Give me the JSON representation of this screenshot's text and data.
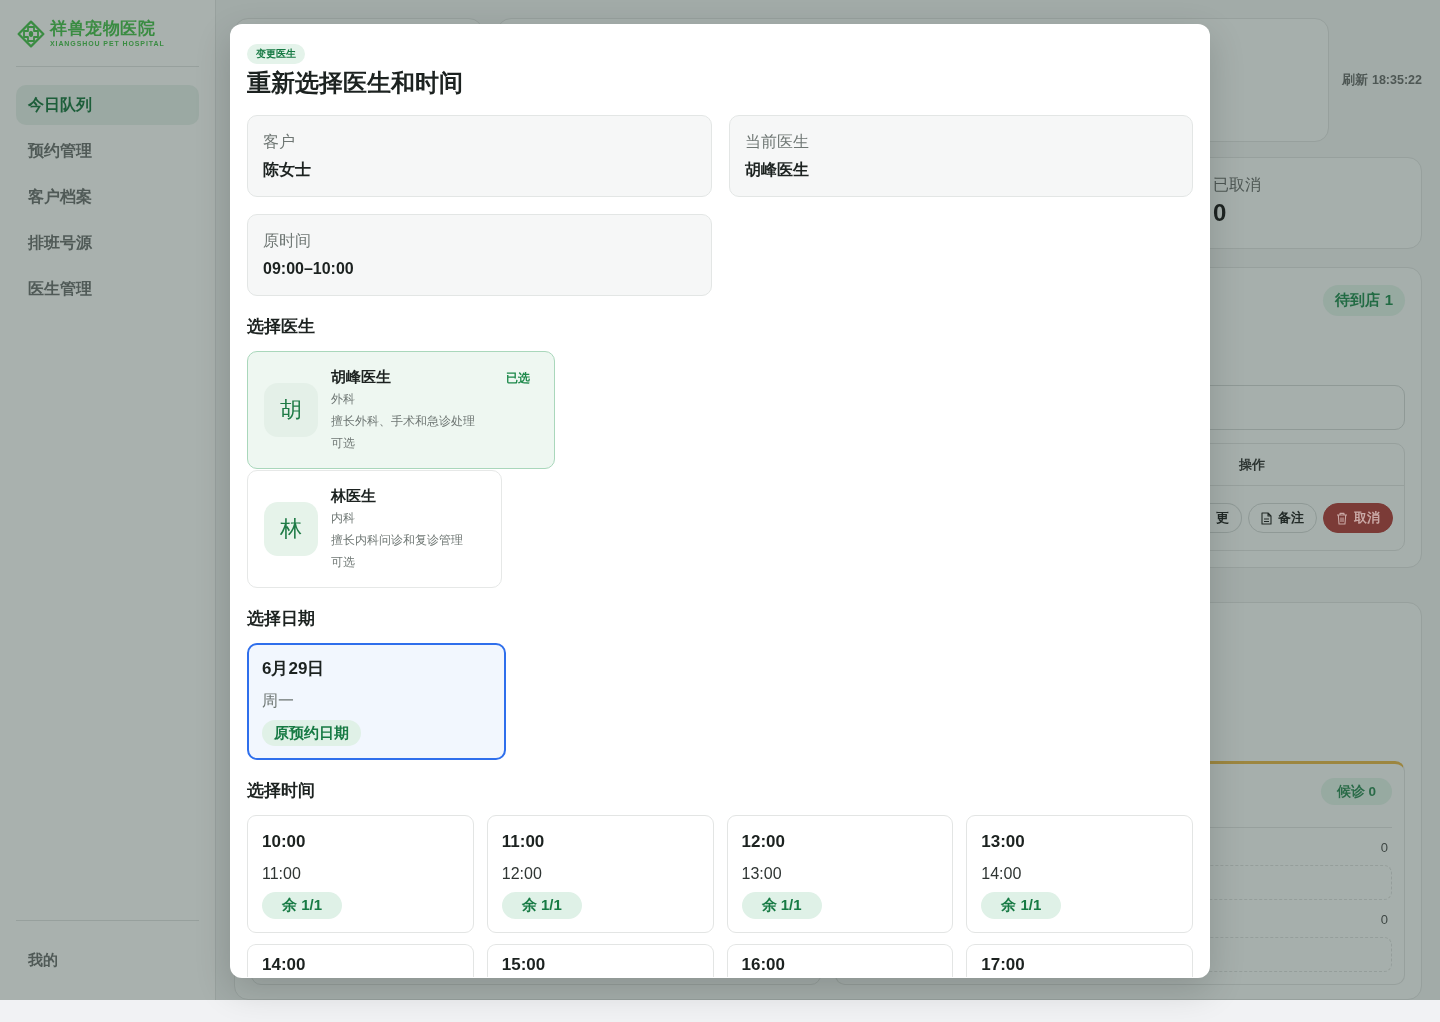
{
  "sidebar": {
    "logo": {
      "name": "祥兽宠物医院",
      "subtitle": "XIANGSHOU PET HOSPITAL"
    },
    "items": [
      {
        "label": "今日队列",
        "selected": true
      },
      {
        "label": "预约管理",
        "selected": false
      },
      {
        "label": "客户档案",
        "selected": false
      },
      {
        "label": "排班号源",
        "selected": false
      },
      {
        "label": "医生管理",
        "selected": false
      }
    ],
    "footer_item": {
      "label": "我的"
    }
  },
  "header": {
    "refresh": "刷新 18:35:22"
  },
  "stats": [
    {
      "label": "已取消",
      "value": "0"
    }
  ],
  "arrivals_panel": {
    "badge": "待到店 1",
    "table": {
      "columns": [
        "操作"
      ],
      "row_actions": [
        {
          "label": "更",
          "kind": "plain"
        },
        {
          "label": "备注",
          "kind": "note"
        },
        {
          "label": "取消",
          "kind": "danger"
        }
      ]
    }
  },
  "waiting_panel": {
    "badge": "候诊 0",
    "groups": [
      {
        "count": "0"
      },
      {
        "count": "0"
      }
    ]
  },
  "modal": {
    "tag": "变更医生",
    "title": "重新选择医生和时间",
    "info": [
      {
        "label": "客户",
        "value": "陈女士"
      },
      {
        "label": "当前医生",
        "value": "胡峰医生"
      },
      {
        "label": "原时间",
        "value": "09:00–10:00"
      }
    ],
    "doctor_section": {
      "heading": "选择医生",
      "doctors": [
        {
          "avatar": "胡",
          "name": "胡峰医生",
          "department": "外科",
          "specialty": "擅长外科、手术和急诊处理",
          "availability": "可选",
          "selected": true,
          "selected_label": "已选"
        },
        {
          "avatar": "林",
          "name": "林医生",
          "department": "内科",
          "specialty": "擅长内科问诊和复诊管理",
          "availability": "可选",
          "selected": false
        }
      ]
    },
    "date_section": {
      "heading": "选择日期",
      "dates": [
        {
          "date": "6月29日",
          "weekday": "周一",
          "tag": "原预约日期",
          "selected": true
        }
      ]
    },
    "time_section": {
      "heading": "选择时间",
      "slots": [
        {
          "start": "10:00",
          "end": "11:00",
          "remaining": "余 1/1"
        },
        {
          "start": "11:00",
          "end": "12:00",
          "remaining": "余 1/1"
        },
        {
          "start": "12:00",
          "end": "13:00",
          "remaining": "余 1/1"
        },
        {
          "start": "13:00",
          "end": "14:00",
          "remaining": "余 1/1"
        },
        {
          "start": "14:00"
        },
        {
          "start": "15:00"
        },
        {
          "start": "16:00"
        },
        {
          "start": "17:00"
        }
      ]
    }
  }
}
